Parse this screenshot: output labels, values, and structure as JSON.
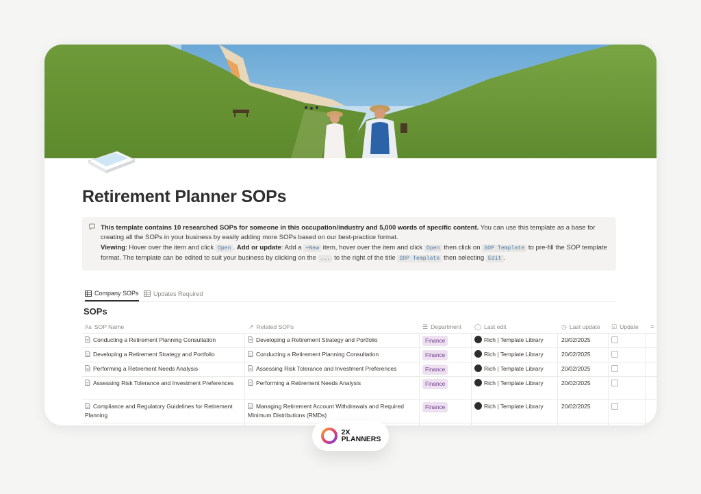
{
  "page": {
    "title": "Retirement Planner SOPs"
  },
  "callout": {
    "bold_intro": "This template contains 10 researched SOPs for someone in this occupation/industry and 5,000 words of specific content.",
    "intro_rest": " You can use this template as a base for creating all the SOPs in your business by easily adding more SOPs based on our best-practice format.",
    "viewing_label": "Viewing",
    "viewing_text": ": Hover over the item and click ",
    "open_code": "Open",
    "add_label": "Add or update",
    "add_text1": ": Add a ",
    "new_code": "+New",
    "add_text2": " item, hover over the item and click ",
    "open_code2": "Open",
    "add_text3": " then click on ",
    "sop_template_code": "SOP Template",
    "add_text4": " to pre-fill the SOP template format. The template can be edited to suit your business by clicking on the ",
    "dots_code": "...",
    "add_text5": " to the right of the title ",
    "sop_template_code2": "SOP Template",
    "add_text6": " then selecting ",
    "edit_code": "Edit",
    "end": "."
  },
  "tabs": [
    {
      "label": "Company SOPs",
      "active": true
    },
    {
      "label": "Updates Required",
      "active": false
    }
  ],
  "section_title": "SOPs",
  "columns": {
    "sop_name": "SOP Name",
    "related": "Related SOPs",
    "department": "Department",
    "last_edit": "Last edit",
    "last_update": "Last update",
    "update": "Update"
  },
  "rows": [
    {
      "name": "Conducting a Retirement Planning Consultation",
      "related": "Developing a Retirement Strategy and Portfolio",
      "department": "Finance",
      "editor": "Rich | Template Library",
      "date": "20/02/2025"
    },
    {
      "name": "Developing a Retirement Strategy and Portfolio",
      "related": "Conducting a Retirement Planning Consultation",
      "department": "Finance",
      "editor": "Rich | Template Library",
      "date": "20/02/2025"
    },
    {
      "name": "Performing a Retirement Needs Analysis",
      "related": "Assessing Risk Tolerance and Investment Preferences",
      "department": "Finance",
      "editor": "Rich | Template Library",
      "date": "20/02/2025"
    },
    {
      "name": "Assessing Risk Tolerance and Investment Preferences",
      "related": "Performing a Retirement Needs Analysis",
      "department": "Finance",
      "editor": "Rich | Template Library",
      "date": "20/02/2025"
    },
    {
      "name": "Compliance and Regulatory Guidelines for Retirement Planning",
      "related": "Managing Retirement Account Withdrawals and Required Minimum Distributions (RMDs)",
      "department": "Finance",
      "editor": "Rich | Template Library",
      "date": "20/02/2025"
    }
  ],
  "brand": {
    "line1": "2X",
    "line2": "PLANNERS"
  }
}
